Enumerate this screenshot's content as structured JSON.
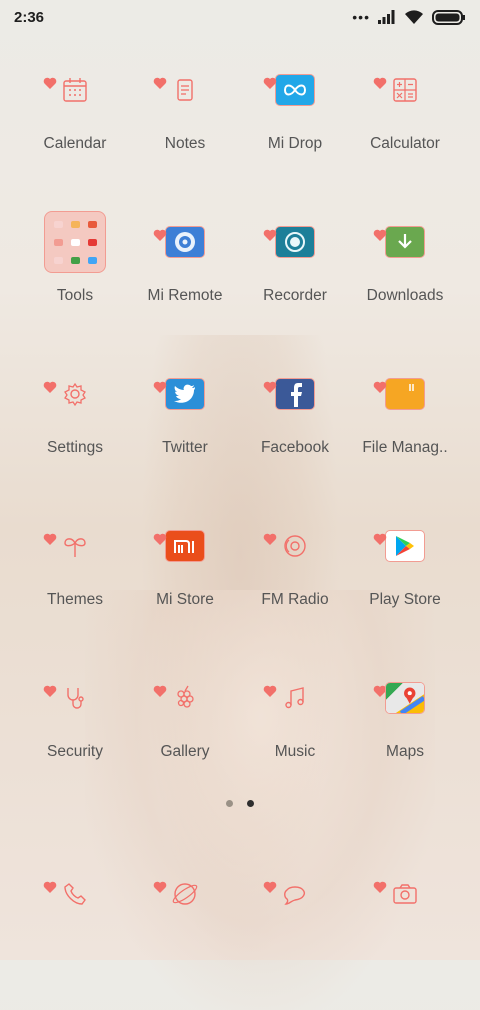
{
  "status": {
    "time": "2:36"
  },
  "colors": {
    "accent": "#f2706a",
    "outline": "#f29c92"
  },
  "apps": [
    {
      "label": "Calendar",
      "icon": "calendar-icon"
    },
    {
      "label": "Notes",
      "icon": "notes-icon"
    },
    {
      "label": "Mi Drop",
      "icon": "mi-drop-icon"
    },
    {
      "label": "Calculator",
      "icon": "calculator-icon"
    },
    {
      "label": "Tools",
      "icon": "tools-folder-icon"
    },
    {
      "label": "Mi Remote",
      "icon": "mi-remote-icon"
    },
    {
      "label": "Recorder",
      "icon": "recorder-icon"
    },
    {
      "label": "Downloads",
      "icon": "downloads-icon"
    },
    {
      "label": "Settings",
      "icon": "settings-icon"
    },
    {
      "label": "Twitter",
      "icon": "twitter-icon"
    },
    {
      "label": "Facebook",
      "icon": "facebook-icon"
    },
    {
      "label": "File Manag..",
      "icon": "file-manager-icon"
    },
    {
      "label": "Themes",
      "icon": "themes-icon"
    },
    {
      "label": "Mi Store",
      "icon": "mi-store-icon"
    },
    {
      "label": "FM Radio",
      "icon": "fm-radio-icon"
    },
    {
      "label": "Play Store",
      "icon": "play-store-icon"
    },
    {
      "label": "Security",
      "icon": "security-icon"
    },
    {
      "label": "Gallery",
      "icon": "gallery-icon"
    },
    {
      "label": "Music",
      "icon": "music-icon"
    },
    {
      "label": "Maps",
      "icon": "maps-icon"
    }
  ],
  "page_indicator": {
    "pages": 2,
    "active": 2
  },
  "dock": [
    {
      "icon": "phone-icon"
    },
    {
      "icon": "browser-icon"
    },
    {
      "icon": "messaging-icon"
    },
    {
      "icon": "camera-icon"
    }
  ]
}
